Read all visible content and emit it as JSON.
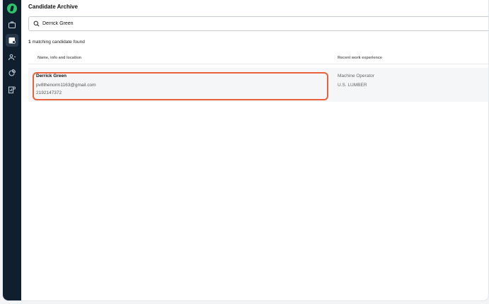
{
  "app": {
    "title": "Candidate Archive"
  },
  "search": {
    "value": "Derrick Green",
    "placeholder": ""
  },
  "results": {
    "count": "1",
    "count_suffix": " matching candidate found"
  },
  "table": {
    "columns": [
      "Name, info and location",
      "Recent work experience"
    ],
    "rows": [
      {
        "name": "Derrick Green",
        "email": "pv8thenorm1163@gmail.com",
        "phone": "2192147372",
        "job_title": "Machine Operator",
        "company": "U.S. LUMBER"
      }
    ]
  },
  "sidebar": {
    "items": [
      {
        "icon": "briefcase-icon"
      },
      {
        "icon": "candidate-archive-icon",
        "active": true
      },
      {
        "icon": "users-icon"
      },
      {
        "icon": "analytics-icon"
      },
      {
        "icon": "reports-icon"
      }
    ]
  },
  "colors": {
    "sidebar": "#0f1f2e",
    "brand": "#2fc46a",
    "highlight": "#e8613c",
    "row_bg": "#f4f6f8"
  }
}
